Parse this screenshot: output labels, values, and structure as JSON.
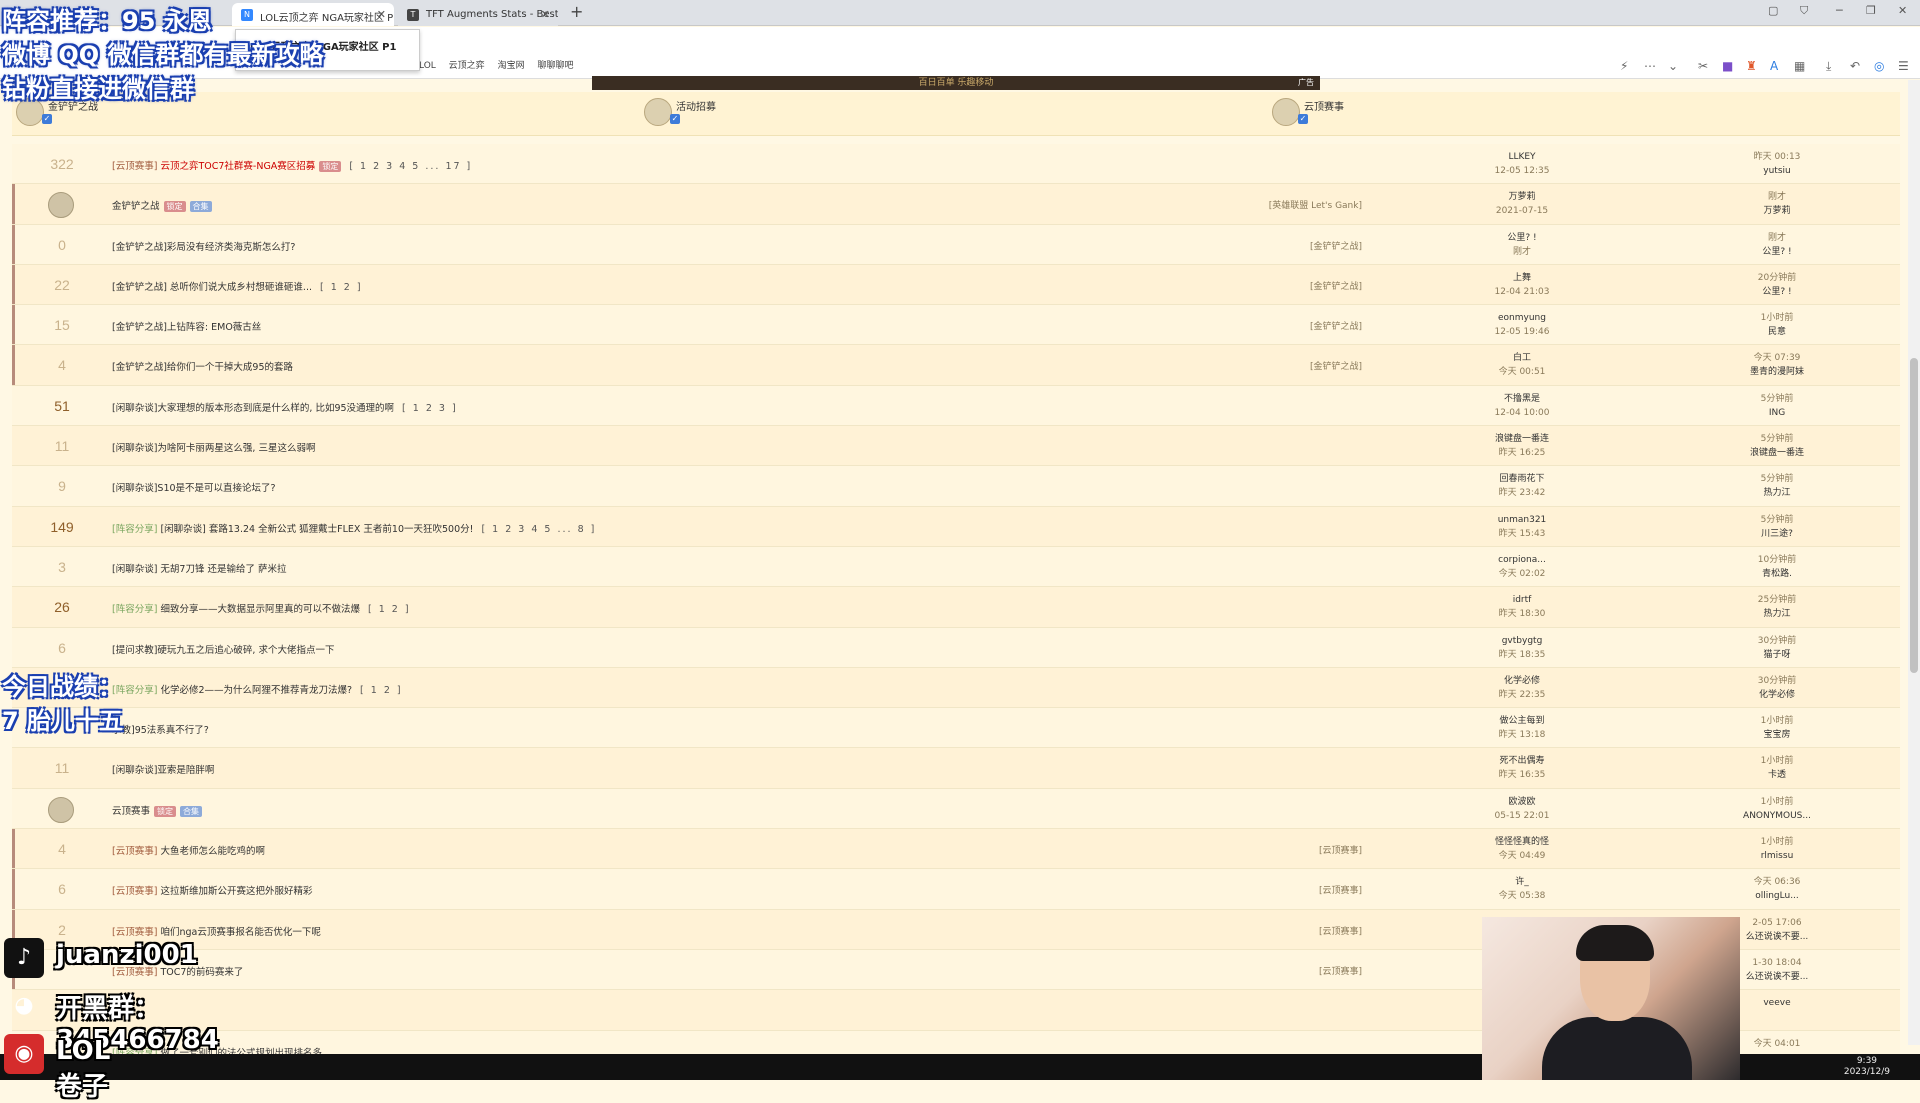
{
  "browser": {
    "tabs": [
      {
        "label": "LOL云顶之弈 NGA玩家社区 P",
        "active": true,
        "favicon": "nga-icon"
      },
      {
        "label": "TFT Augments Stats - Best",
        "active": false,
        "favicon": "tft-icon"
      }
    ],
    "tooltip": "LOL云顶之弈 NGA玩家社区 P1",
    "bookmarks": [
      "@LOL",
      "云顶之弈",
      "淘宝网",
      "聊聊聊吧"
    ]
  },
  "banner": {
    "text": "百日百单 乐趣移动",
    "ad": "广告"
  },
  "forums": [
    {
      "name": "金铲铲之战",
      "checked": true
    },
    {
      "name": "活动招募",
      "checked": true
    },
    {
      "name": "云顶赛事",
      "checked": true
    }
  ],
  "rows": [
    {
      "count": "322",
      "hot": false,
      "tag": "[云顶赛事]",
      "title": "云顶之弈TOC7社群赛-NGA赛区招募",
      "red": true,
      "badge": "锁定",
      "pages": "[ 1 2 3 4 5 ... 17 ]",
      "cat": "",
      "author": "LLKEY",
      "adate": "12-05 12:35",
      "lastTime": "昨天 00:13",
      "lastUser": "yutsiu",
      "mark": false
    },
    {
      "count": "",
      "avatar": true,
      "tag": "",
      "title": "金铲铲之战",
      "red": false,
      "badge": "锁定",
      "badge2": "合集",
      "pages": "",
      "cat": "[英雄联盟 Let's Gank]",
      "author": "万萝莉",
      "adate": "2021-07-15",
      "lastTime": "刚才",
      "lastUser": "万萝莉",
      "mark": true
    },
    {
      "count": "0",
      "hot": false,
      "tag": "",
      "title": "[金铲铲之战]彩局没有经济类海克斯怎么打?",
      "pages": "",
      "cat": "[金铲铲之战]",
      "author": "公里? !",
      "adate": "刚才",
      "lastTime": "刚才",
      "lastUser": "公里? !",
      "mark": true
    },
    {
      "count": "22",
      "hot": false,
      "tag": "",
      "title": "[金铲铲之战] 总听你们说大成乡村想砸谁砸谁...",
      "pages": "[ 1 2 ]",
      "cat": "[金铲铲之战]",
      "author": "上舞",
      "adate": "12-04 21:03",
      "lastTime": "20分钟前",
      "lastUser": "公里? !",
      "mark": true
    },
    {
      "count": "15",
      "hot": false,
      "tag": "",
      "title": "[金铲铲之战]上钻阵容: EMO薇古丝",
      "pages": "",
      "cat": "[金铲铲之战]",
      "author": "eonmyung",
      "adate": "12-05 19:46",
      "lastTime": "1小时前",
      "lastUser": "民意",
      "mark": true
    },
    {
      "count": "4",
      "hot": false,
      "tag": "",
      "title": "[金铲铲之战]给你们一个干掉大成95的套路",
      "pages": "",
      "cat": "[金铲铲之战]",
      "author": "白工",
      "adate": "今天 00:51",
      "lastTime": "今天 07:39",
      "lastUser": "墨青的漫阿妹",
      "mark": true
    },
    {
      "count": "51",
      "hot": true,
      "tag": "",
      "title": "[闲聊杂谈]大家理想的版本形态到底是什么样的, 比如95没通理的啊",
      "pages": "[ 1 2 3 ]",
      "cat": "",
      "author": "不撸黑是",
      "adate": "12-04 10:00",
      "lastTime": "5分钟前",
      "lastUser": "ING",
      "mark": false
    },
    {
      "count": "11",
      "hot": false,
      "tag": "",
      "title": "[闲聊杂谈]为啥阿卡丽两星这么强, 三星这么弱啊",
      "pages": "",
      "cat": "",
      "author": "浪键盘一番连",
      "adate": "昨天 16:25",
      "lastTime": "5分钟前",
      "lastUser": "浪键盘一番连",
      "mark": false
    },
    {
      "count": "9",
      "hot": false,
      "tag": "",
      "title": "[闲聊杂谈]S10是不是可以直接论坛了?",
      "pages": "",
      "cat": "",
      "author": "回春雨花下",
      "adate": "昨天 23:42",
      "lastTime": "5分钟前",
      "lastUser": "热力江",
      "mark": false
    },
    {
      "count": "149",
      "hot": true,
      "tag": "[阵容分享]",
      "tagGreen": true,
      "title": "[闲聊杂谈] 套路13.24 全新公式 狐狸戴士FLEX 王者前10一天狂吹500分!",
      "pages": "[ 1 2 3 4 5 ... 8 ]",
      "cat": "",
      "author": "unman321",
      "adate": "昨天 15:43",
      "lastTime": "5分钟前",
      "lastUser": "川三途?",
      "mark": false
    },
    {
      "count": "3",
      "hot": false,
      "tag": "",
      "title": "[闲聊杂谈] 无胡7刀锋 还是输给了 萨米拉",
      "pages": "",
      "cat": "",
      "author": "corpiona...",
      "adate": "今天 02:02",
      "lastTime": "10分钟前",
      "lastUser": "青松路.",
      "mark": false
    },
    {
      "count": "26",
      "hot": true,
      "tag": "[阵容分享]",
      "tagGreen": true,
      "title": "细致分享——大数据显示阿里真的可以不做法爆",
      "pages": "[ 1 2 ]",
      "cat": "",
      "author": "idrtf",
      "adate": "昨天 18:30",
      "lastTime": "25分钟前",
      "lastUser": "热力江",
      "mark": false
    },
    {
      "count": "6",
      "hot": false,
      "tag": "",
      "title": "[提问求教]硬玩九五之后追心破碎, 求个大佬指点一下",
      "pages": "",
      "cat": "",
      "author": "gvtbygtg",
      "adate": "昨天 18:35",
      "lastTime": "30分钟前",
      "lastUser": "猫子呀",
      "mark": false
    },
    {
      "count": "",
      "hot": false,
      "tag": "[阵容分享]",
      "tagGreen": true,
      "title": "化学必修2——为什么阿狸不推荐青龙刀法爆?",
      "pages": "[ 1 2 ]",
      "cat": "",
      "author": "化学必修",
      "adate": "昨天 22:35",
      "lastTime": "30分钟前",
      "lastUser": "化学必修",
      "mark": false
    },
    {
      "count": "",
      "hot": false,
      "tag": "",
      "title": "求教]95法系真不行了?",
      "pages": "",
      "cat": "",
      "author": "做公主每到",
      "adate": "昨天 13:18",
      "lastTime": "1小时前",
      "lastUser": "宝宝房",
      "mark": false
    },
    {
      "count": "11",
      "hot": false,
      "tag": "",
      "title": "[闲聊杂谈]亚索是陪胖啊",
      "pages": "",
      "cat": "",
      "author": "死不出偶寿",
      "adate": "昨天 16:35",
      "lastTime": "1小时前",
      "lastUser": "卡透",
      "mark": false
    },
    {
      "count": "",
      "avatar": true,
      "tag": "",
      "title": "云顶赛事",
      "red": false,
      "badge": "锁定",
      "badge2": "合集",
      "pages": "",
      "cat": "",
      "author": "欧波欧",
      "adate": "05-15 22:01",
      "lastTime": "1小时前",
      "lastUser": "ANONYMOUS...",
      "mark": false
    },
    {
      "count": "4",
      "hot": false,
      "tag": "[云顶赛事]",
      "title": "大鱼老师怎么能吃鸡的啊",
      "pages": "",
      "cat": "[云顶赛事]",
      "author": "怪怪怪真的怪",
      "adate": "今天 04:49",
      "lastTime": "1小时前",
      "lastUser": "rlmissu",
      "mark": true
    },
    {
      "count": "6",
      "hot": false,
      "tag": "[云顶赛事]",
      "title": "这拉斯维加斯公开赛这把外服好精彩",
      "pages": "",
      "cat": "[云顶赛事]",
      "author": "许_",
      "adate": "今天 05:38",
      "lastTime": "今天 06:36",
      "lastUser": "ollingLu...",
      "mark": true
    },
    {
      "count": "2",
      "hot": false,
      "tag": "[云顶赛事]",
      "title": "咱们nga云顶赛事报名能否优化一下呢",
      "pages": "",
      "cat": "[云顶赛事]",
      "author": "",
      "adate": "",
      "lastTime": "2-05 17:06",
      "lastUser": "么还说诶不要...",
      "mark": true
    },
    {
      "count": "",
      "hot": false,
      "tag": "[云顶赛事]",
      "title": "TOC7的前码赛来了",
      "pages": "",
      "cat": "[云顶赛事]",
      "author": "",
      "adate": "",
      "lastTime": "1-30 18:04",
      "lastUser": "么还说诶不要...",
      "mark": true
    },
    {
      "count": "",
      "hot": false,
      "tag": "",
      "title": "",
      "pages": "",
      "cat": "",
      "author": "",
      "adate": "",
      "lastTime": "",
      "lastUser": "veeve",
      "mark": false
    },
    {
      "count": "",
      "hot": false,
      "tag": "[阵容分享]",
      "tagGreen": true,
      "title": "做了一套别们的法公式规划出现排名多",
      "pages": "",
      "cat": "",
      "author": "",
      "adate": "",
      "lastTime": "今天 04:01",
      "lastUser": "",
      "mark": false
    }
  ],
  "overlays": {
    "top": [
      "阵容推荐：95 永恩",
      "微博 QQ 微信群都有最新攻略",
      "钻粉直接进微信群"
    ],
    "mid": [
      "今日战绩：",
      "7 胎儿十五"
    ],
    "tiktok": "juanzi001",
    "qq": "开黑群：345466784",
    "weibo": "LOL卷子"
  },
  "taskbar": {
    "time": "9:39",
    "date": "2023/12/9"
  }
}
